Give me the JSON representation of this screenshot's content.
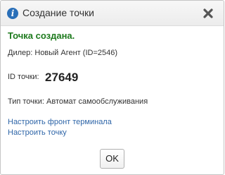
{
  "dialog": {
    "title": "Создание точки",
    "icon": "info-icon",
    "close_icon": "close-icon"
  },
  "content": {
    "success_message": "Точка создана.",
    "dealer_label": "Дилер:",
    "dealer_value": "Новый Агент (ID=2546)",
    "id_label": "ID точки:",
    "id_value": "27649",
    "type_label": "Тип точки:",
    "type_value": "Автомат самообслуживания"
  },
  "links": {
    "configure_front": "Настроить фронт терминала",
    "configure_point": "Настроить точку"
  },
  "footer": {
    "ok_label": "OK"
  },
  "colors": {
    "success": "#1d7a1d",
    "link": "#2f66a8",
    "info_icon": "#2a6fb8"
  }
}
